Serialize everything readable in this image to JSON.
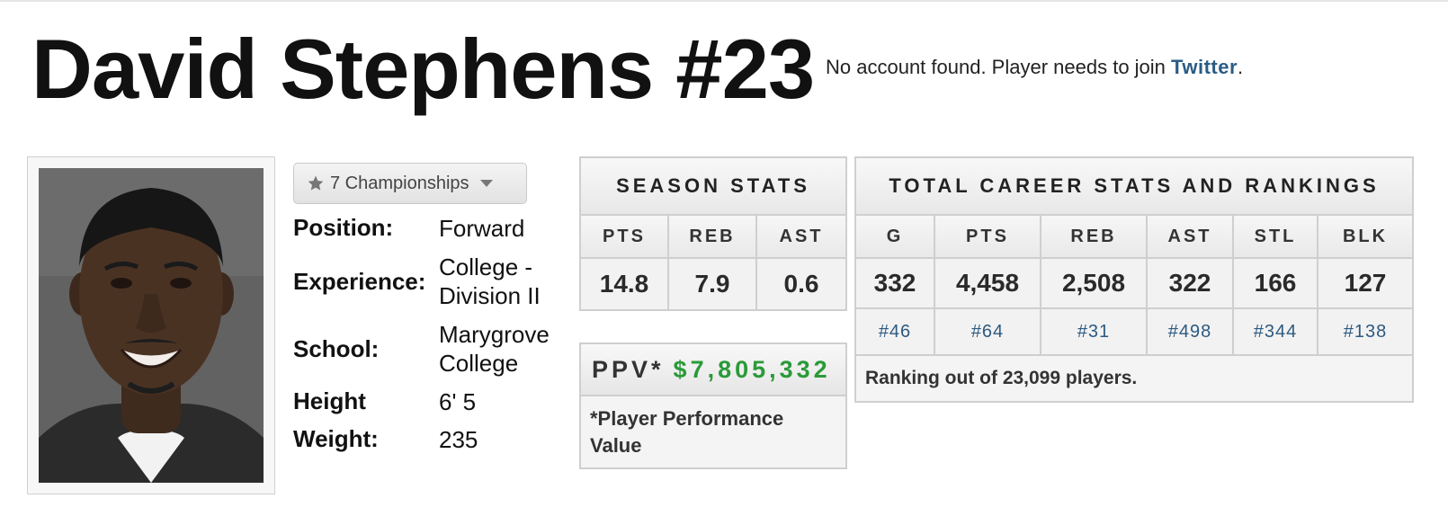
{
  "header": {
    "player_name": "David Stephens #23",
    "twitter_note": "No account found. Player needs to join",
    "twitter_link": "Twitter",
    "twitter_period": "."
  },
  "championships": {
    "label": "7 Championships"
  },
  "bio": {
    "position_label": "Position:",
    "position": "Forward",
    "experience_label": "Experience:",
    "experience": "College - Division II",
    "school_label": "School:",
    "school": "Marygrove College",
    "height_label": "Height",
    "height": "6' 5",
    "weight_label": "Weight:",
    "weight": "235"
  },
  "season_stats": {
    "title": "SEASON STATS",
    "headers": [
      "PTS",
      "REB",
      "AST"
    ],
    "values": [
      "14.8",
      "7.9",
      "0.6"
    ]
  },
  "career_stats": {
    "title": "TOTAL CAREER STATS AND RANKINGS",
    "headers": [
      "G",
      "PTS",
      "REB",
      "AST",
      "STL",
      "BLK"
    ],
    "values": [
      "332",
      "4,458",
      "2,508",
      "322",
      "166",
      "127"
    ],
    "ranks": [
      "#46",
      "#64",
      "#31",
      "#498",
      "#344",
      "#138"
    ],
    "footer": "Ranking out of 23,099 players."
  },
  "ppv": {
    "label": "PPV*",
    "amount": "$7,805,332",
    "note": "*Player Performance Value"
  },
  "colors": {
    "link": "#2a5c85",
    "money": "#2a9a38"
  }
}
